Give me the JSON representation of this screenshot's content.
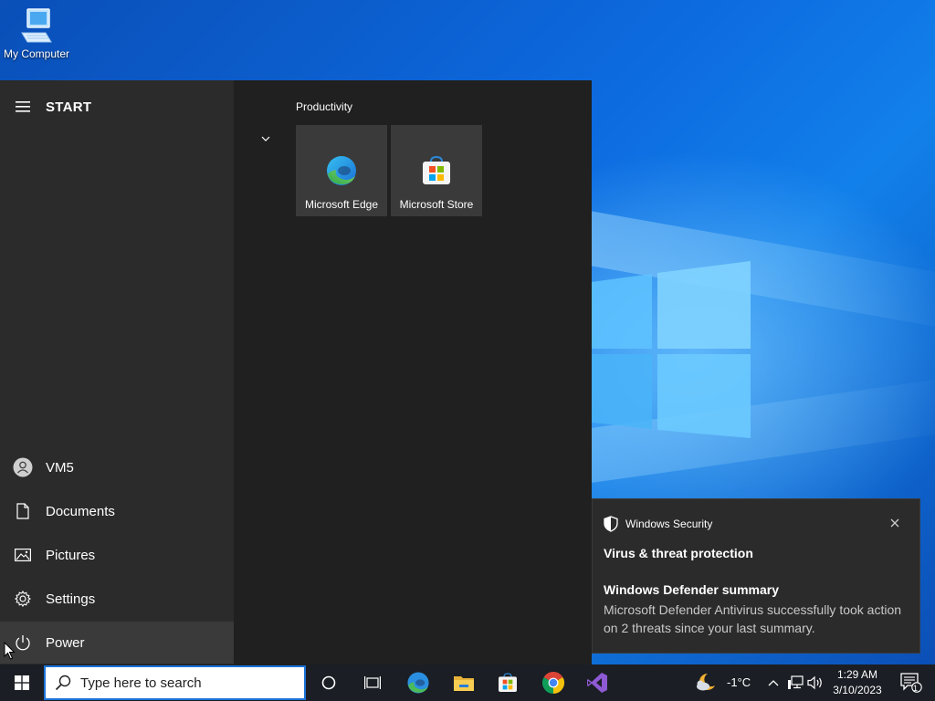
{
  "desktop": {
    "icons": [
      {
        "label": "My Computer",
        "icon": "computer-icon"
      }
    ]
  },
  "start_menu": {
    "title": "START",
    "user": "VM5",
    "items": [
      {
        "label": "Documents",
        "icon": "document-icon"
      },
      {
        "label": "Pictures",
        "icon": "pictures-icon"
      },
      {
        "label": "Settings",
        "icon": "gear-icon"
      },
      {
        "label": "Power",
        "icon": "power-icon"
      }
    ],
    "group_title": "Productivity",
    "tiles": [
      {
        "label": "Microsoft Edge",
        "icon": "edge-icon"
      },
      {
        "label": "Microsoft Store",
        "icon": "store-icon"
      }
    ]
  },
  "notification": {
    "app": "Windows Security",
    "heading": "Virus & threat protection",
    "subheading": "Windows Defender summary",
    "body": "Microsoft Defender Antivirus successfully took action on 2 threats since your last summary."
  },
  "taskbar": {
    "search_placeholder": "Type here to search",
    "apps": [
      "start-icon",
      "cortana-icon",
      "task-view-icon",
      "edge-icon",
      "file-explorer-icon",
      "store-icon",
      "chrome-icon",
      "visual-studio-icon"
    ],
    "weather": "-1°C",
    "time": "1:29 AM",
    "date": "3/10/2023",
    "notification_count": "1"
  },
  "colors": {
    "start_bg": "#202020",
    "start_left_bg": "#2b2b2b",
    "tile_bg": "#3a3a3a",
    "taskbar_bg": "#1b1e24",
    "accent": "#1a73d9"
  }
}
